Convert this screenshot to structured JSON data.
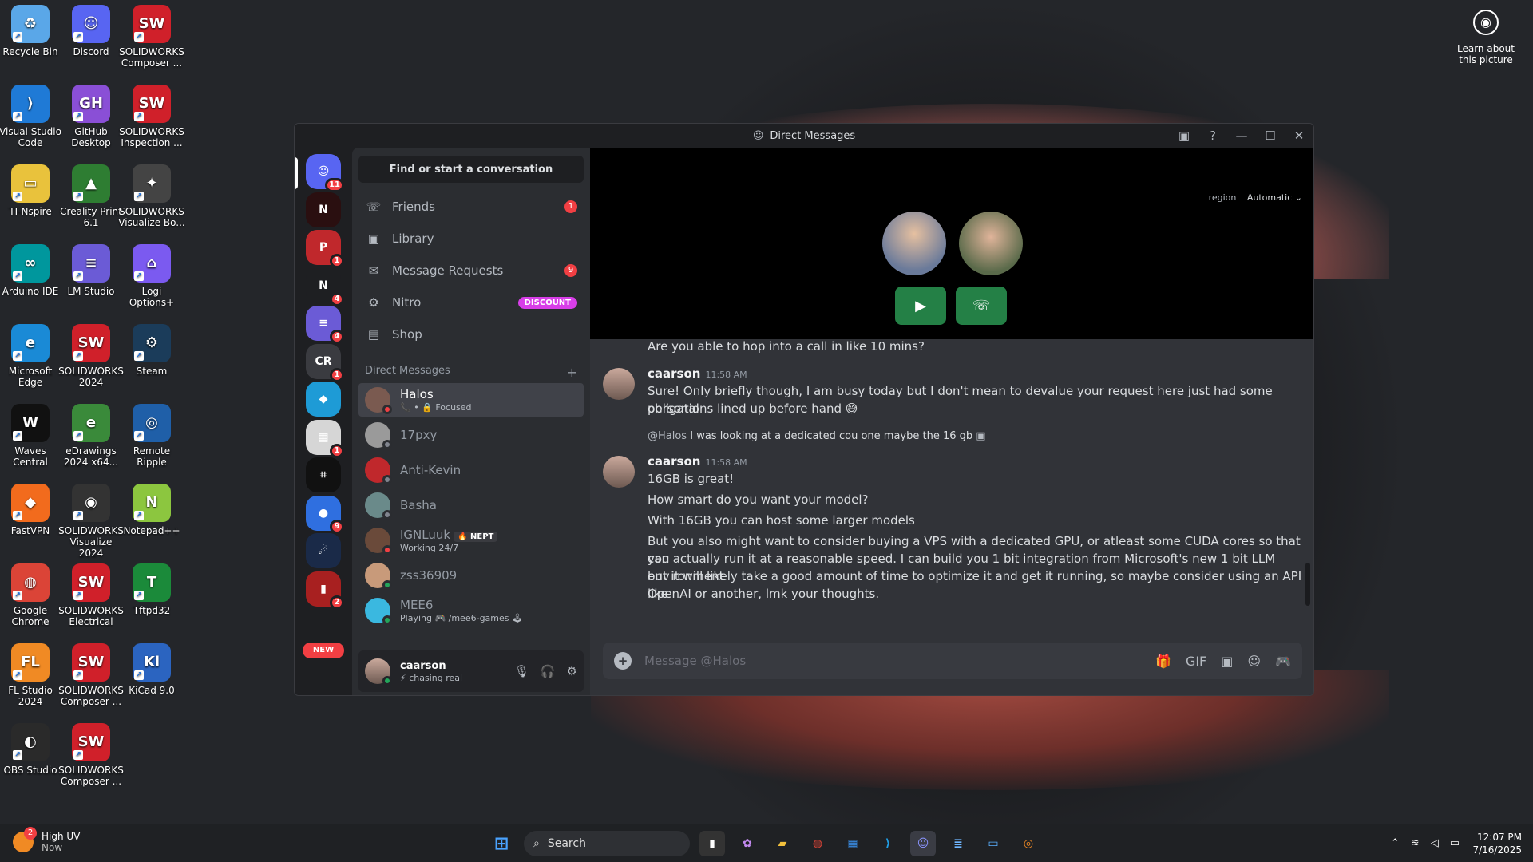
{
  "desktop": {
    "icons": [
      {
        "label": "Recycle Bin",
        "color": "#5aa7e8",
        "glyph": "♻"
      },
      {
        "label": "Discord",
        "color": "#5865f2",
        "glyph": "☺"
      },
      {
        "label": "SOLIDWORKS Composer ...",
        "color": "#d0202a",
        "glyph": "SW"
      },
      {
        "label": "Visual Studio Code",
        "color": "#1f7ad6",
        "glyph": "⟩"
      },
      {
        "label": "GitHub Desktop",
        "color": "#8a4fd6",
        "glyph": "GH"
      },
      {
        "label": "SOLIDWORKS Inspection ...",
        "color": "#d0202a",
        "glyph": "SW"
      },
      {
        "label": "TI-Nspire",
        "color": "#e9c23c",
        "glyph": "▭"
      },
      {
        "label": "Creality Print 6.1",
        "color": "#2e7d32",
        "glyph": "▲"
      },
      {
        "label": "SOLIDWORKS Visualize Bo...",
        "color": "#444",
        "glyph": "✦"
      },
      {
        "label": "Arduino IDE",
        "color": "#00979d",
        "glyph": "∞"
      },
      {
        "label": "LM Studio",
        "color": "#6b5bd6",
        "glyph": "≡"
      },
      {
        "label": "Logi Options+",
        "color": "#7b5af0",
        "glyph": "⌂"
      },
      {
        "label": "Microsoft Edge",
        "color": "#1a8ad6",
        "glyph": "e"
      },
      {
        "label": "SOLIDWORKS 2024",
        "color": "#d0202a",
        "glyph": "SW"
      },
      {
        "label": "Steam",
        "color": "#1b3c5a",
        "glyph": "⚙"
      },
      {
        "label": "Waves Central",
        "color": "#111",
        "glyph": "W"
      },
      {
        "label": "eDrawings 2024 x64...",
        "color": "#3a8a3a",
        "glyph": "e"
      },
      {
        "label": "Remote Ripple",
        "color": "#1f5fa8",
        "glyph": "◎"
      },
      {
        "label": "FastVPN",
        "color": "#f26b1d",
        "glyph": "◆"
      },
      {
        "label": "SOLIDWORKS Visualize 2024",
        "color": "#333",
        "glyph": "◉"
      },
      {
        "label": "Notepad++",
        "color": "#8cc63f",
        "glyph": "N"
      },
      {
        "label": "Google Chrome",
        "color": "#db4437",
        "glyph": "◍"
      },
      {
        "label": "SOLIDWORKS Electrical",
        "color": "#d0202a",
        "glyph": "SW"
      },
      {
        "label": "Tftpd32",
        "color": "#1b8a3a",
        "glyph": "T"
      },
      {
        "label": "FL Studio 2024",
        "color": "#f08a24",
        "glyph": "FL"
      },
      {
        "label": "SOLIDWORKS Composer ...",
        "color": "#d0202a",
        "glyph": "SW"
      },
      {
        "label": "KiCad 9.0",
        "color": "#2b64c0",
        "glyph": "Ki"
      },
      {
        "label": "OBS Studio",
        "color": "#2a2a2a",
        "glyph": "◐"
      },
      {
        "label": "SOLIDWORKS Composer ...",
        "color": "#d0202a",
        "glyph": "SW"
      }
    ],
    "learn_label": "Learn about this picture"
  },
  "window": {
    "title": "Direct Messages"
  },
  "guilds": [
    {
      "glyph": "☺",
      "color": "#5865f2",
      "badge": "11"
    },
    {
      "glyph": "N",
      "color": "#2a0f10",
      "badge": ""
    },
    {
      "glyph": "P",
      "color": "#c0282c",
      "badge": "1"
    },
    {
      "glyph": "N",
      "color": "#1e1f22",
      "badge": "4"
    },
    {
      "glyph": "≡",
      "color": "#6b5bd6",
      "badge": "4"
    },
    {
      "glyph": "CR",
      "color": "#3a3b40",
      "badge": "1"
    },
    {
      "glyph": "◆",
      "color": "#1e9bd6",
      "badge": ""
    },
    {
      "glyph": "▦",
      "color": "#d6d6d6",
      "badge": "1"
    },
    {
      "glyph": "⌗",
      "color": "#111",
      "badge": ""
    },
    {
      "glyph": "●",
      "color": "#2f6fe0",
      "badge": "9"
    },
    {
      "glyph": "☄",
      "color": "#1a2a48",
      "badge": ""
    },
    {
      "glyph": "▮",
      "color": "#a82020",
      "badge": "2"
    }
  ],
  "new_label": "NEW",
  "sidebar": {
    "find_label": "Find or start a conversation",
    "nav": [
      {
        "label": "Friends",
        "icon": "☏",
        "badge": "1"
      },
      {
        "label": "Library",
        "icon": "▣",
        "badge": ""
      },
      {
        "label": "Message Requests",
        "icon": "✉",
        "badge": "9"
      },
      {
        "label": "Nitro",
        "icon": "⚙",
        "badge": ""
      },
      {
        "label": "Shop",
        "icon": "▤",
        "badge": ""
      }
    ],
    "nitro_badge": "DISCOUNT",
    "dm_header": "Direct Messages",
    "dm_add": "+",
    "dms": [
      {
        "name": "Halos",
        "sub": "📞 • 🔒 Focused",
        "status": "#f23f43",
        "color": "#7a5a50"
      },
      {
        "name": "17pxy",
        "sub": "",
        "status": "#80848e",
        "color": "#9a9a9a"
      },
      {
        "name": "Anti-Kevin",
        "sub": "",
        "status": "#80848e",
        "color": "#c0282c"
      },
      {
        "name": "Basha",
        "sub": "",
        "status": "#80848e",
        "color": "#6a8a8a"
      },
      {
        "name": "IGNLuuk",
        "sub": "Working 24/7",
        "status": "#f23f43",
        "color": "#6a4a3a",
        "tag": "🔥 NEPT"
      },
      {
        "name": "zss36909",
        "sub": "",
        "status": "#23a55a",
        "color": "#c89a7a"
      },
      {
        "name": "MEE6",
        "sub": "Playing 🎮 /mee6-games 🕹",
        "status": "#23a55a",
        "color": "#3ab8e0"
      }
    ],
    "user": {
      "name": "caarson",
      "status": "⚡ chasing real"
    }
  },
  "call": {
    "region_label": "region",
    "region_value": "Automatic ⌄"
  },
  "messages": {
    "top_line": "Are you able to hop into a call in like 10 mins?",
    "m1": {
      "author": "caarson",
      "time": "11:58 AM",
      "l1": "Sure! Only briefly though, I am busy today but I don't mean to devalue your request here just had some personal",
      "l2": "obligations lined up before hand 😅"
    },
    "reply": {
      "mention": "@Halos",
      "text": "I was looking at a dedicated cou one maybe the 16 gb"
    },
    "m2": {
      "author": "caarson",
      "time": "11:58 AM",
      "l1": "16GB is great!",
      "l2": "How smart do you want your model?",
      "l3": "With 16GB you can host some larger models",
      "l4": "But you also might want to consider buying a VPS with a dedicated GPU, or atleast some CUDA cores so that you",
      "l5": "can actually run it at a reasonable speed. I can build you 1 bit integration from Microsoft's new 1 bit LLM environment",
      "l6": "but it will likely take a good amount of time to optimize it and get it running, so maybe consider using an API like",
      "l7": "OpenAI or another, lmk your thoughts."
    },
    "input_placeholder": "Message @Halos"
  },
  "taskbar": {
    "weather_title": "High UV",
    "weather_sub": "Now",
    "weather_badge": "2",
    "search_label": "Search",
    "time": "12:07 PM",
    "date": "7/16/2025"
  },
  "colors": {
    "accent": "#5865f2",
    "green": "#248046",
    "red": "#f23f43",
    "bg": "#313338"
  }
}
